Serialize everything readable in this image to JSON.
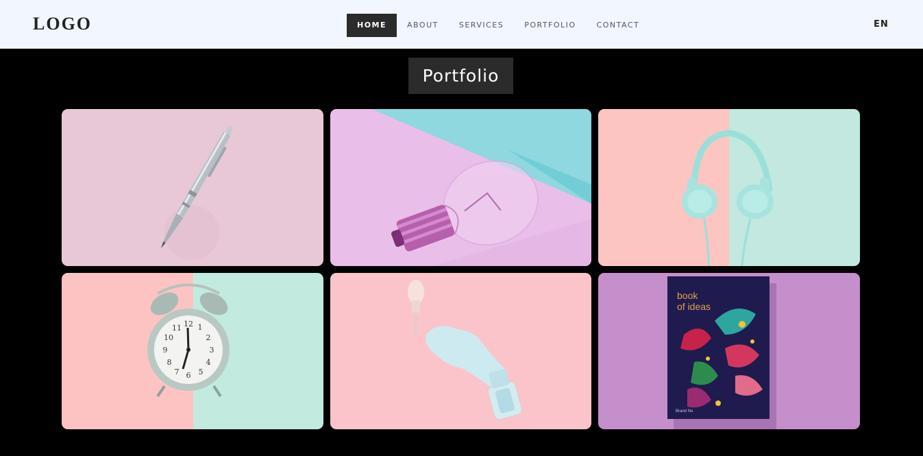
{
  "header": {
    "logo": "LOGO",
    "nav": [
      {
        "label": "HOME",
        "active": true
      },
      {
        "label": "ABOUT",
        "active": false
      },
      {
        "label": "SERVICES",
        "active": false
      },
      {
        "label": "PORTFOLIO",
        "active": false
      },
      {
        "label": "CONTACT",
        "active": false
      }
    ],
    "language": "EN"
  },
  "portfolio": {
    "title": "Portfolio",
    "items": [
      {
        "subject": "pen",
        "bg": "#e8c8d6"
      },
      {
        "subject": "light-bulb",
        "bg": "#e9bfe9",
        "accent": "#8fd8e0"
      },
      {
        "subject": "headphones",
        "bg_left": "#fcc5c1",
        "bg_right": "#c2e8df"
      },
      {
        "subject": "alarm-clock",
        "bg_left": "#fdc3c2",
        "bg_right": "#c2eadf"
      },
      {
        "subject": "nail-polish",
        "bg": "#fbc4ca"
      },
      {
        "subject": "book",
        "bg": "#c58fcc",
        "book_title": "book of ideas",
        "book_publisher": "Brand No"
      }
    ]
  }
}
